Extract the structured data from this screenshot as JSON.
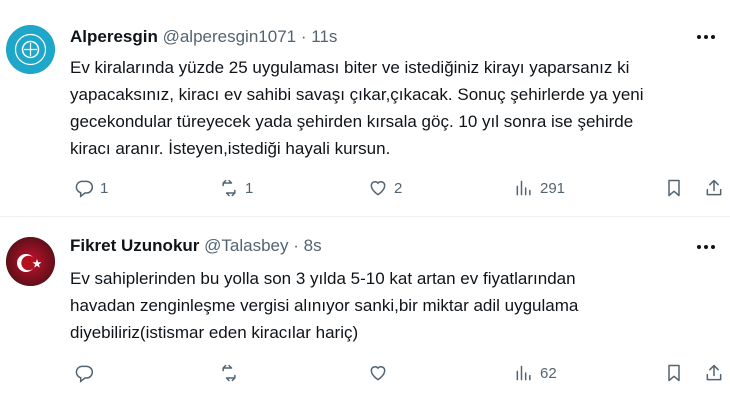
{
  "tweets": [
    {
      "name": "Alperesgin",
      "handle": "@alperesgin1071",
      "separator": "·",
      "time": "11s",
      "lines": [
        "Ev kiralarında yüzde 25 uygulaması biter ve istediğiniz kirayı yaparsanız ki",
        "yapacaksınız, kiracı ev sahibi savaşı çıkar,çıkacak. Sonuç şehirlerde ya yeni",
        "gecekondular türeyecek yada şehirden kırsala göç. 10 yıl sonra ise şehirde",
        "kiracı aranır. İsteyen,istediği hayali kursun."
      ],
      "replies": "1",
      "retweets": "1",
      "likes": "2",
      "views": "291",
      "avatar_icon": "turkic-council-logo-icon"
    },
    {
      "name": "Fikret Uzunokur",
      "handle": "@Talasbey",
      "separator": "·",
      "time": "8s",
      "lines": [
        "Ev sahiplerinden bu yolla son 3 yılda 5-10 kat artan ev fiyatlarından",
        "havadan zenginleşme vergisi alınıyor sanki,bir miktar adil uygulama",
        "diyebiliriz(istismar eden kiracılar hariç)"
      ],
      "replies": "",
      "retweets": "",
      "likes": "",
      "views": "62",
      "avatar_icon": "turkish-flag-icon"
    }
  ],
  "colors": {
    "text": "#0f1419",
    "secondary": "#536471",
    "divider": "#eff3f4",
    "avatar0": "#1ea7c9",
    "avatar1_flag": "#c8102e"
  }
}
